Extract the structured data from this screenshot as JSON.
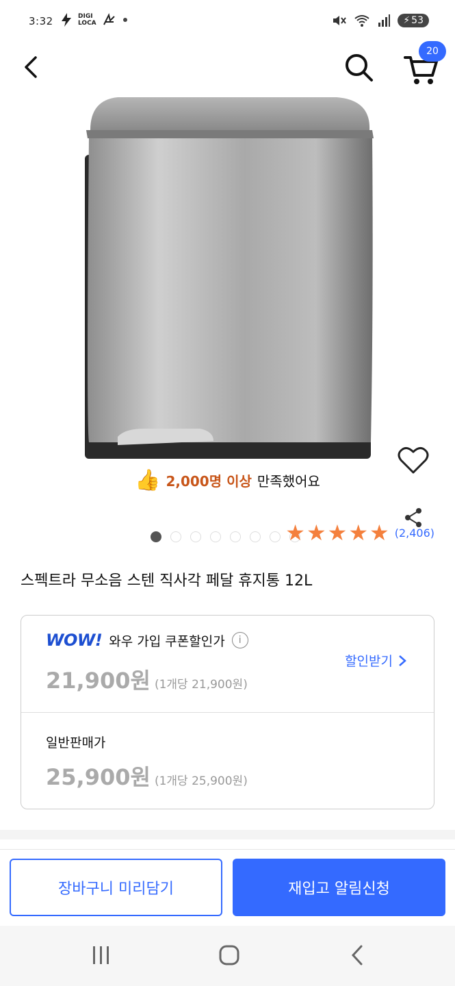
{
  "status_bar": {
    "time": "3:32",
    "digi_top": "DIGI",
    "digi_bottom": "LOCA",
    "battery": "53"
  },
  "header": {
    "cart_badge": "20"
  },
  "product": {
    "image_dots_total": 8,
    "image_dots_active": 1,
    "satisfaction_highlight": "2,000명 이상",
    "satisfaction_rest": "만족했어요",
    "review_count": "(2,406)",
    "rating_stars": 5,
    "title": "스펙트라 무소음 스텐 직사각 페달 휴지통 12L"
  },
  "pricing": {
    "wow_logo": "WOW!",
    "wow_label": "와우 가입 쿠폰할인가",
    "wow_price": "21,900원",
    "wow_unit": "(1개당 21,900원)",
    "discount_link": "할인받기",
    "normal_label": "일반판매가",
    "normal_price": "25,900원",
    "normal_unit": "(1개당 25,900원)"
  },
  "actions": {
    "add_to_cart": "장바구니 미리담기",
    "restock_alert": "재입고 알림신청"
  },
  "colors": {
    "accent": "#346aff",
    "star": "#f4803d",
    "highlight": "#c8561a"
  },
  "icons": [
    "back-arrow-icon",
    "search-icon",
    "cart-icon",
    "heart-icon",
    "share-icon",
    "thumbs-up-icon",
    "info-icon",
    "chevron-right-icon",
    "recents-icon",
    "home-icon",
    "nav-back-icon"
  ]
}
